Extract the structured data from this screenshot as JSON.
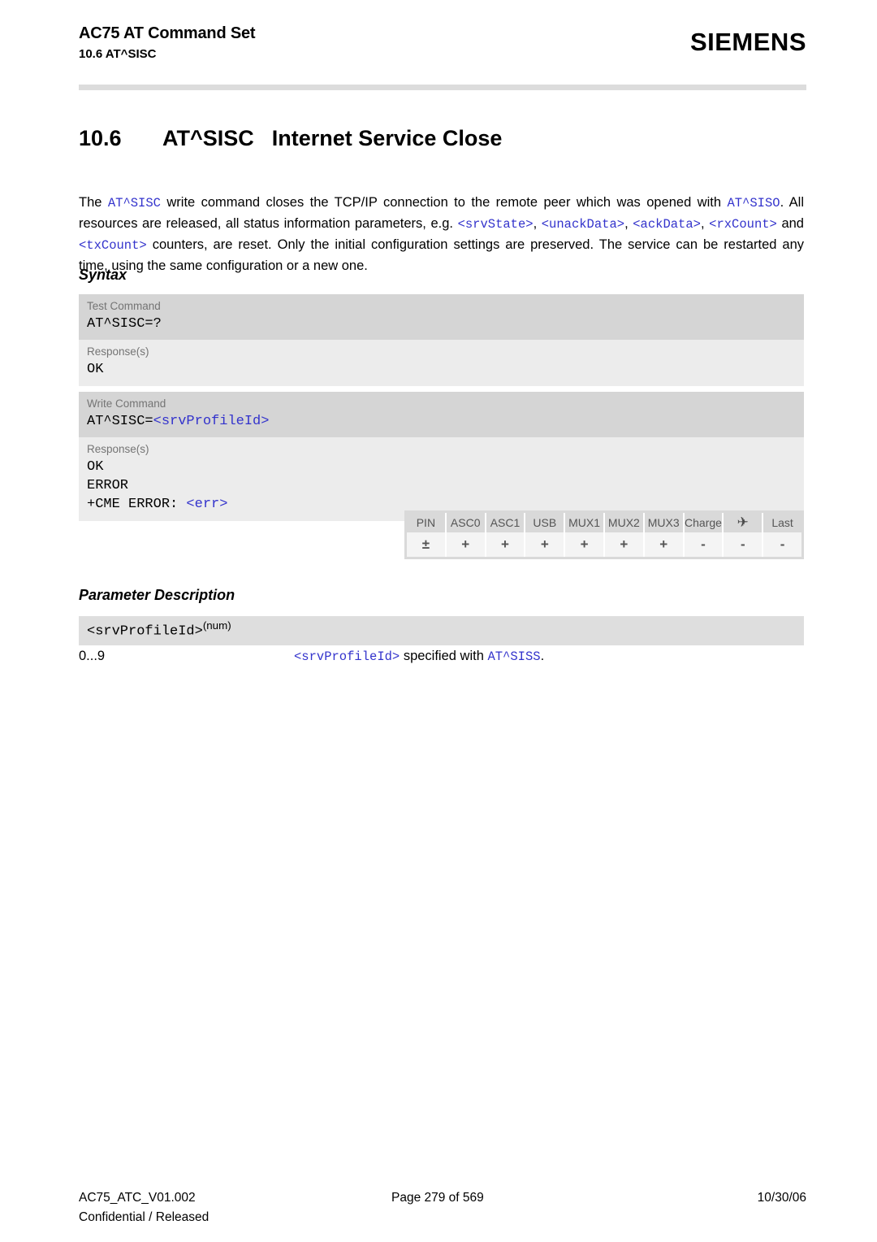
{
  "header": {
    "title": "AC75 AT Command Set",
    "subtitle": "10.6 AT^SISC",
    "brand": "SIEMENS"
  },
  "section": {
    "number": "10.6",
    "command": "AT^SISC",
    "title": "Internet Service Close"
  },
  "intro": {
    "t1": "The ",
    "c1": "AT^SISC",
    "t2": " write command closes the TCP/IP connection to the remote peer which was opened with ",
    "c2": "AT^SISO",
    "t3": ". All resources are released, all status information parameters, e.g. ",
    "c3": "<srvState>",
    "t4": ", ",
    "c4": "<unackData>",
    "t5": ", ",
    "c5": "<ackData>",
    "t6": ", ",
    "c6": "<rxCount>",
    "t7": " and ",
    "c7": "<txCount>",
    "t8": " counters, are reset. Only the initial configuration settings are preserved. The service can be restarted any time, using the same configuration or a new one."
  },
  "syntax": {
    "heading": "Syntax",
    "test": {
      "command_label": "Test Command",
      "command": "AT^SISC=?",
      "response_label": "Response(s)",
      "response": "OK"
    },
    "write": {
      "command_label": "Write Command",
      "command_prefix": "AT^SISC=",
      "command_param": "<srvProfileId>",
      "response_label": "Response(s)",
      "response_ok": "OK",
      "response_error": "ERROR",
      "response_cme_prefix": "+CME ERROR: ",
      "response_cme_param": "<err>"
    }
  },
  "capabilities": {
    "columns": [
      "PIN",
      "ASC0",
      "ASC1",
      "USB",
      "MUX1",
      "MUX2",
      "MUX3",
      "Charge",
      "✈",
      "Last"
    ],
    "values": [
      "±",
      "+",
      "+",
      "+",
      "+",
      "+",
      "+",
      "-",
      "-",
      "-"
    ]
  },
  "parameters": {
    "heading": "Parameter Description",
    "name": "<srvProfileId>",
    "type": "(num)",
    "rows": [
      {
        "value": "0...9",
        "desc_param": "<srvProfileId>",
        "desc_text": " specified with ",
        "desc_cmd": "AT^SISS",
        "desc_end": "."
      }
    ]
  },
  "footer": {
    "document": "AC75_ATC_V01.002",
    "page": "Page 279 of 569",
    "date": "10/30/06",
    "classification": "Confidential / Released"
  }
}
